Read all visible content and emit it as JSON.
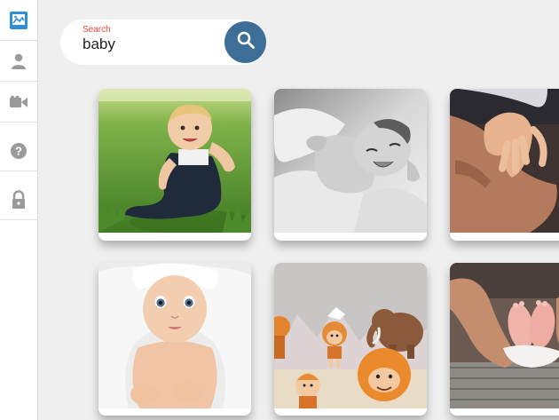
{
  "sidebar": {
    "items": [
      {
        "icon": "gallery-icon",
        "active": true
      },
      {
        "icon": "user-icon",
        "active": false
      },
      {
        "icon": "video-camera-icon",
        "active": false
      },
      {
        "icon": "help-icon",
        "active": false
      },
      {
        "icon": "lock-icon",
        "active": false
      }
    ]
  },
  "search": {
    "label": "Search",
    "value": "baby",
    "button_icon": "search-icon"
  },
  "colors": {
    "accent": "#3c6e98",
    "sidebar_active": "#2e8fd8",
    "label": "#e6463c"
  },
  "gallery": {
    "images": [
      {
        "name": "baby-on-grass"
      },
      {
        "name": "baby-black-and-white"
      },
      {
        "name": "hands-together"
      },
      {
        "name": "baby-in-towel"
      },
      {
        "name": "cartoon-cavemen"
      },
      {
        "name": "baby-feet-in-hands"
      }
    ]
  }
}
